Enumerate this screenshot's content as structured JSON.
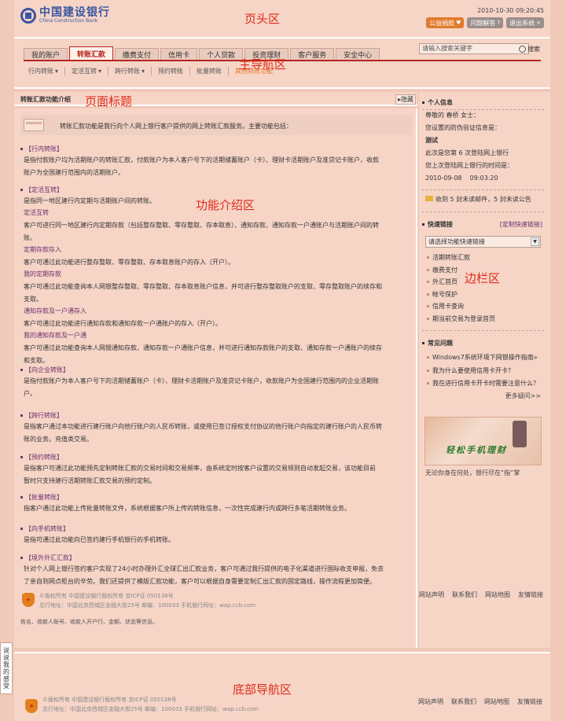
{
  "zones": {
    "header": "页头区",
    "mainnav": "主导航区",
    "pagetitle": "页面标题",
    "content": "功能介绍区",
    "sidebar": "边栏区",
    "footer": "底部导航区"
  },
  "header": {
    "logo_cn": "中国建设银行",
    "logo_en": "China Construction Bank",
    "datetime": "2010-10-30 09:20:45",
    "charity": "公益捐款",
    "help": "问题解答",
    "logout": "退出系统"
  },
  "nav": {
    "tabs": [
      "我的账户",
      "转账汇款",
      "缴费支付",
      "信用卡",
      "个人贷款",
      "投资理财",
      "客户服务",
      "安全中心"
    ],
    "active_tab": "转账汇款",
    "search_placeholder": "请输入搜索关键字",
    "search_label": "搜索",
    "subnav": [
      "行内转账",
      "定活互转",
      "跨行转账",
      "预约转账",
      "批量转账",
      "其他转账功能"
    ]
  },
  "page": {
    "title": "转账汇款功能介绍",
    "hide": "隐藏",
    "intro": "转账汇款功能是我行向个人网上银行客户提供的网上转账汇款服务。主要功能包括：",
    "sections": [
      {
        "title": "【行内转账】",
        "desc": [
          "是指付款账户均为活期账户的转账汇款，付款账户为本人客户号下的活期储蓄账户（卡）、理财卡活期账户及准贷记卡账户，收款",
          "账户为全国建行范围内的活期账户。"
        ]
      },
      {
        "title": "【定活互转】",
        "desc": [
          "是指同一地区建行内定期与活期账户间的转账。"
        ],
        "subs": [
          {
            "link": "定活互转",
            "desc": [
              "客户可进行同一地区建行内定期存款（包括整存整取、零存整取、存本取息）、通知存款、通知存款一户通账户与活期账户间的转",
              "账。"
            ]
          },
          {
            "link": "定期存款存入",
            "desc": [
              "客户可通过此功能进行整存整取、零存整取、存本取息账户的存入（开户）。"
            ]
          },
          {
            "link": "我的定期存款",
            "desc": [
              "客户可通过此功能查询本人网银整存整取、零存整取、存本取息账户信息，并可进行整存整取账户的支取、零存整取账户的续存和",
              "支取。"
            ]
          },
          {
            "link": "通知存款及一户通存入",
            "desc": [
              "客户可通过此功能进行通知存款和通知存款一户通账户的存入（开户）。"
            ]
          },
          {
            "link": "我的通知存款及一户通",
            "desc": [
              "客户可通过此功能查询本人网银通知存款、通知存款一户通账户信息，并可进行通知存款账户的支取、通知存款一户通账户的续存",
              "和支取。"
            ]
          }
        ]
      },
      {
        "title": "【向企业转账】",
        "desc": [
          "是指付款账户为本人客户号下的活期储蓄账户（卡）、理财卡活期账户及准贷记卡账户，收款账户为全国建行范围内的企业活期账",
          "户。"
        ]
      },
      {
        "title": "【跨行转账】",
        "desc": [
          "是指客户通过本功能进行建行账户向他行账户的人民币转账，或使用已签订授权支付协议的他行账户向指定的建行账户的人民币转",
          "账的业务。充值类交易。"
        ]
      },
      {
        "title": "【预约转账】",
        "desc": [
          "是指客户可通过此功能预先定制转账汇款的交易时间和交易频率，由系统定时按客户设置的交易规则自动发起交易，该功能目前",
          "暂时只支持建行活期转账汇款交易的预约定制。"
        ]
      },
      {
        "title": "【批量转账】",
        "desc": [
          "指客户通过此功能上传批量转账文件，系统根据客户所上传的转账信息，一次性完成建行内或跨行多笔活期转账业务。"
        ]
      },
      {
        "title": "【向手机转账】",
        "desc": [
          "是指可通过此功能向已签约建行手机银行的手机转账。"
        ]
      },
      {
        "title": "【境外外汇汇款】",
        "desc": [
          "针对个人网上银行签约客户实现了24小时办理外汇全球汇出汇款业务，客户可通过我行提供的电子化渠道进行国际收支申报，免去",
          "了亲自到网点柜台的辛劳。我们还提供了模版汇款功能，客户可以根据自身需要定制汇出汇款的固定路线，操作流程更加简便。"
        ]
      }
    ],
    "copyright_1": "©版权所有  中国建设银行版权所有  京ICP证 050138号",
    "copyright_2": "总行地址：中国北京西城区金融大街25号  邮编：100033  手机银行网址：wap.ccb.com",
    "content_footer": "姓名、收款人账号、收款人开户行、金额、状态等信息。"
  },
  "sidebar": {
    "personal_title": "个人信息",
    "greeting": "尊敬的  春桥  女士：",
    "verify_label": "您设置的防伪验证信息是：",
    "verify_value": "测试",
    "login_count": "此次是您第 6 次登陆网上银行",
    "last_login_label": "您上次登陆网上银行的时间是：",
    "last_login_date": "2010-09-08",
    "last_login_time": "09:03:20",
    "mail_notice": "收到 5 封未读邮件，5 封未读公告",
    "quick_title": "快速链接",
    "quick_custom": "[定制快速链接]",
    "quick_select": "请选择功能快速链接",
    "quick_links": [
      "活期转账汇款",
      "缴费支付",
      "外汇首页",
      "帐号保护",
      "信用卡查询",
      "期当前交易为登录首页"
    ],
    "faq_title": "常见问题",
    "faq": [
      "Windows7系统环境下网银操作指南»",
      "我为什么要使用信用卡开卡？",
      "我在进行信用卡开卡时需要注意什么？"
    ],
    "faq_more": "更多疑问>>",
    "banner_text": "轻松手机理财",
    "banner_caption": "无论你身在何处，银行尽在“指”掌",
    "links": [
      "网站声明",
      "联系我们",
      "网站地图",
      "友情链接"
    ]
  },
  "feedback": "说说我的感受",
  "footer": {
    "copyright_1": "©版权所有  中国建设银行版权所有  京ICP证 050138号",
    "copyright_2": "总行地址：中国北京西城区金融大街25号  邮编：100033  手机银行网址：wap.ccb.com",
    "links": [
      "网站声明",
      "联系我们",
      "网站地图",
      "友情链接"
    ]
  }
}
